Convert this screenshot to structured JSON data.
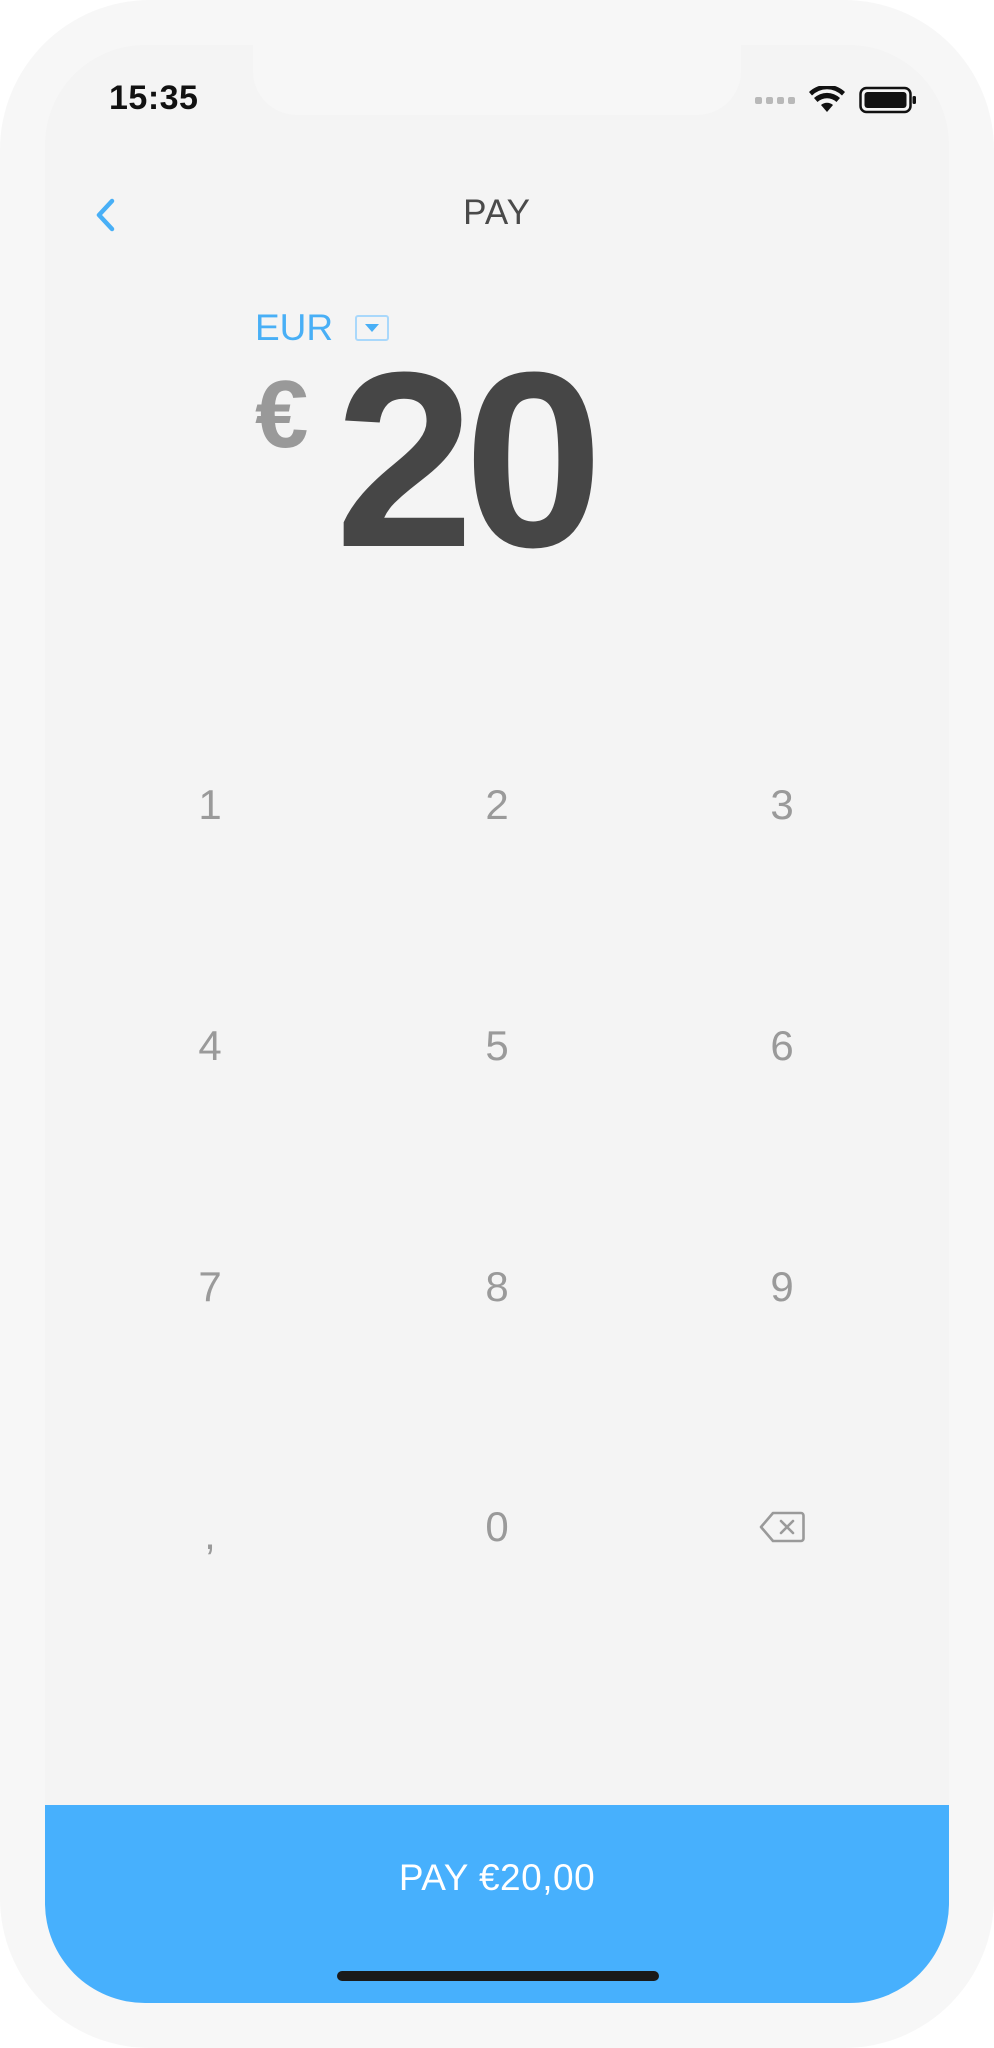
{
  "status_bar": {
    "time": "15:35",
    "signal_icon": "cellular-signal-icon",
    "wifi_icon": "wifi-icon",
    "battery_icon": "battery-icon"
  },
  "nav": {
    "back_icon": "chevron-left-icon",
    "title": "PAY"
  },
  "amount": {
    "currency_code": "EUR",
    "dropdown_icon": "caret-down-icon",
    "currency_symbol": "€",
    "value": "20"
  },
  "keypad": {
    "keys": [
      "1",
      "2",
      "3",
      "4",
      "5",
      "6",
      "7",
      "8",
      "9",
      ",",
      "0"
    ],
    "backspace_icon": "backspace-icon"
  },
  "pay_button": {
    "label": "PAY €20,00"
  },
  "colors": {
    "accent": "#48aff6",
    "button": "#47b0fd",
    "background": "#f4f4f4",
    "amount_text": "#464646",
    "key_text": "#9a9a9a"
  }
}
